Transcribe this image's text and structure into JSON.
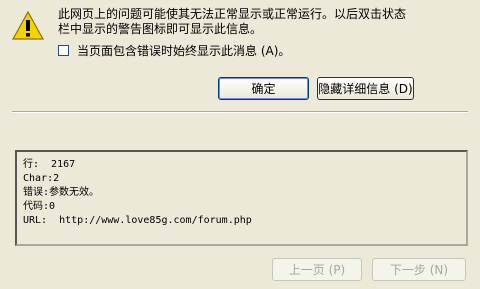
{
  "dialog": {
    "message_line1": "此网页上的问题可能使其无法正常显示或正常运行。以后双击状态",
    "message_line2": "栏中显示的警告图标即可显示此信息。",
    "checkbox_label": "当页面包含错误时始终显示此消息 (A)。",
    "ok_label": "确定",
    "hide_details_label": "隐藏详细信息 (D)",
    "prev_label": "上一页 (P)",
    "next_label": "下一步 (N)",
    "icon": "warning-icon"
  },
  "details": {
    "line": "行:  2167",
    "char": "Char:2",
    "error": "错误:参数无效。",
    "code": "代码:0",
    "url": "URL:  http://www.love85g.com/forum.php"
  }
}
